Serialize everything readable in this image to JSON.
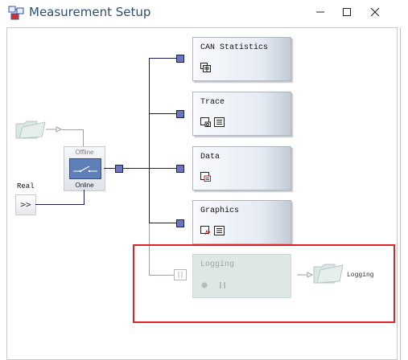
{
  "window": {
    "title": "Measurement Setup",
    "icons": {
      "app": "measurement-setup-icon",
      "minimize": "minimize-icon",
      "maximize": "maximize-icon",
      "close": "close-icon"
    }
  },
  "source": {
    "offline_label": "Offline",
    "online_label": "Online",
    "real_label": "Real",
    "real_button": ">>"
  },
  "blocks": [
    {
      "id": "can-statistics",
      "label": "CAN Statistics",
      "icons": [
        "statistics-window-icon"
      ]
    },
    {
      "id": "trace",
      "label": "Trace",
      "icons": [
        "trace-window-icon",
        "trace-config-icon"
      ]
    },
    {
      "id": "data",
      "label": "Data",
      "icons": [
        "data-window-icon"
      ]
    },
    {
      "id": "graphics",
      "label": "Graphics",
      "icons": [
        "graphics-window-icon",
        "graphics-config-icon"
      ]
    },
    {
      "id": "logging",
      "label": "Logging",
      "icons": [
        "record-icon",
        "pause-icon"
      ],
      "disabled": true
    }
  ],
  "logging_file": {
    "label": "Logging",
    "icon": "folder-icon"
  },
  "colors": {
    "wire": "#1a1f5c",
    "selection": "#e0212a",
    "disabled_block": "#dde8e6"
  }
}
